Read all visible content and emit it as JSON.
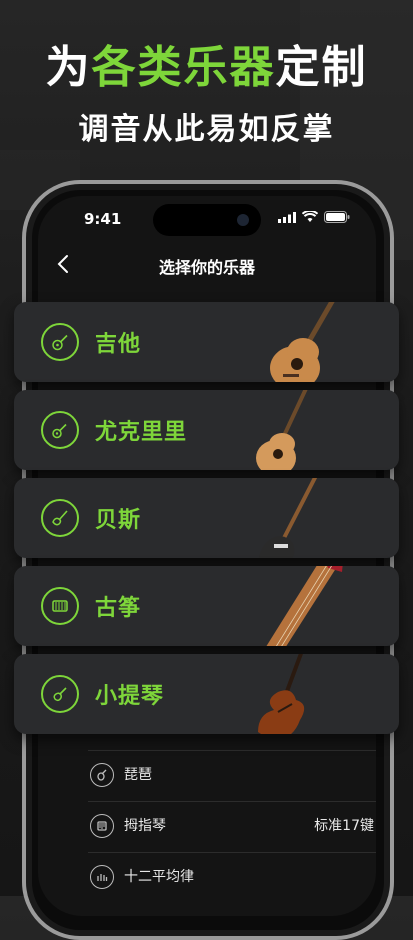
{
  "colors": {
    "accent": "#7ed63a",
    "card": "#2a2b2d"
  },
  "promo": {
    "title_prefix": "为",
    "title_accent": "各类乐器",
    "title_suffix": "定制",
    "subtitle": "调音从此易如反掌"
  },
  "status_bar": {
    "time": "9:41"
  },
  "nav": {
    "title": "选择你的乐器"
  },
  "instruments": [
    {
      "label": "吉他",
      "icon": "guitar-icon"
    },
    {
      "label": "尤克里里",
      "icon": "ukulele-icon"
    },
    {
      "label": "贝斯",
      "icon": "bass-icon"
    },
    {
      "label": "古筝",
      "icon": "guzheng-icon"
    },
    {
      "label": "小提琴",
      "icon": "violin-icon"
    }
  ],
  "more_list": [
    {
      "label": "琵琶",
      "icon": "pipa-icon",
      "value": ""
    },
    {
      "label": "拇指琴",
      "icon": "kalimba-icon",
      "value": "标准17键"
    },
    {
      "label": "十二平均律",
      "icon": "chromatic-icon",
      "value": ""
    }
  ]
}
